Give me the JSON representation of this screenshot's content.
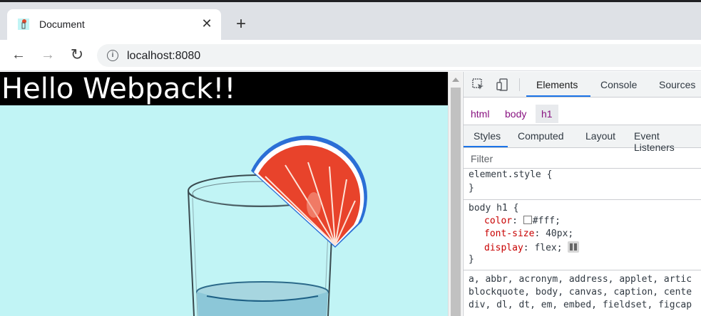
{
  "browser": {
    "tab_title": "Document",
    "tab_close": "✕",
    "new_tab": "+",
    "back": "←",
    "forward": "→",
    "reload": "↻",
    "info": "i",
    "url": "localhost:8080"
  },
  "page": {
    "heading": "Hello Webpack!!",
    "image_desc": "glass-with-grapefruit-slice"
  },
  "devtools": {
    "tabs": [
      "Elements",
      "Console",
      "Sources"
    ],
    "breadcrumbs": [
      "html",
      "body",
      "h1"
    ],
    "sub_tabs": [
      "Styles",
      "Computed",
      "Layout",
      "Event Listeners"
    ],
    "filter_placeholder": "Filter",
    "rules": {
      "element_style_open": "element.style {",
      "element_style_close": "}",
      "selector": "body h1 {",
      "props": [
        {
          "name": "color",
          "value": "#fff;"
        },
        {
          "name": "font-size",
          "value": "40px;"
        },
        {
          "name": "display",
          "value": "flex;"
        }
      ],
      "close": "}",
      "ua_line1": "a, abbr, acronym, address, applet, artic",
      "ua_line2": "blockquote, body, canvas, caption, cente",
      "ua_line3": "div, dl, dt, em, embed, fieldset, figcap"
    }
  },
  "colors": {
    "heading_bg": "#000000",
    "page_bg": "#c1f4f5",
    "devtools_accent": "#1a73e8",
    "breadcrumb_color": "#881280",
    "css_prop_color": "#c80000"
  }
}
